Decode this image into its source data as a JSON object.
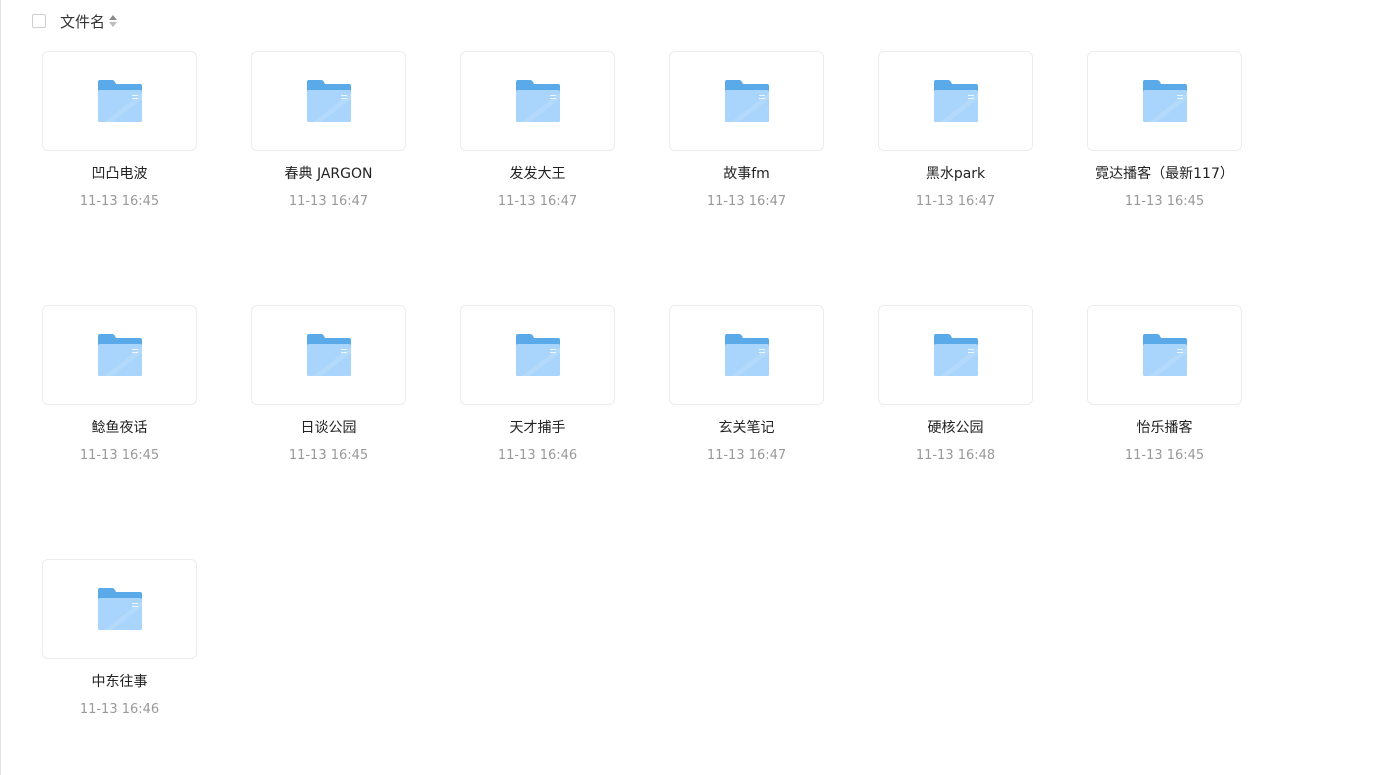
{
  "header": {
    "column_label": "文件名",
    "sort_icon": "sort-updown-icon"
  },
  "colors": {
    "folder_back": "#5aaae9",
    "folder_front": "#a9d4fb"
  },
  "files": [
    {
      "name": "凹凸电波",
      "time": "11-13 16:45",
      "icon": "folder-icon"
    },
    {
      "name": "春典 JARGON",
      "time": "11-13 16:47",
      "icon": "folder-icon"
    },
    {
      "name": "发发大王",
      "time": "11-13 16:47",
      "icon": "folder-icon"
    },
    {
      "name": "故事fm",
      "time": "11-13 16:47",
      "icon": "folder-icon"
    },
    {
      "name": "黑水park",
      "time": "11-13 16:47",
      "icon": "folder-icon"
    },
    {
      "name": "霓达播客（最新117）",
      "time": "11-13 16:45",
      "icon": "folder-icon"
    },
    {
      "name": "鲶鱼夜话",
      "time": "11-13 16:45",
      "icon": "folder-icon"
    },
    {
      "name": "日谈公园",
      "time": "11-13 16:45",
      "icon": "folder-icon"
    },
    {
      "name": "天才捕手",
      "time": "11-13 16:46",
      "icon": "folder-icon"
    },
    {
      "name": "玄关笔记",
      "time": "11-13 16:47",
      "icon": "folder-icon"
    },
    {
      "name": "硬核公园",
      "time": "11-13 16:48",
      "icon": "folder-icon"
    },
    {
      "name": "怡乐播客",
      "time": "11-13 16:45",
      "icon": "folder-icon"
    },
    {
      "name": "中东往事",
      "time": "11-13 16:46",
      "icon": "folder-icon"
    }
  ]
}
